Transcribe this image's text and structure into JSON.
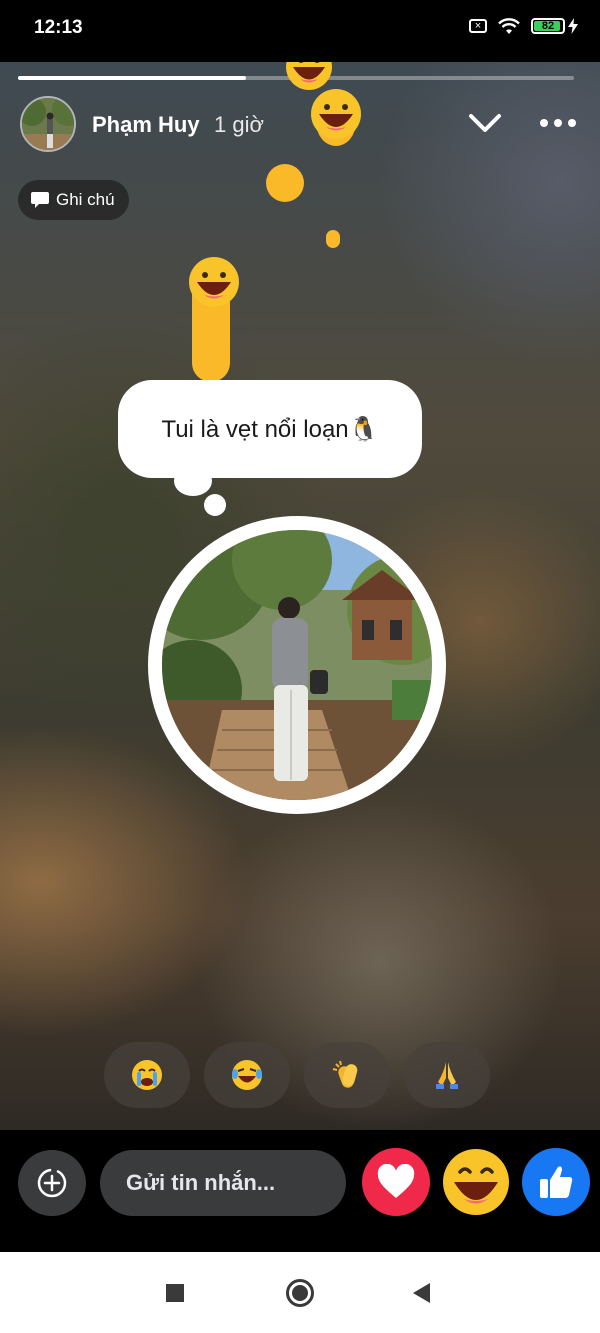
{
  "status_bar": {
    "time": "12:13",
    "battery_level": "82",
    "icons": [
      "sim-x-icon",
      "wifi-icon",
      "battery-icon",
      "charging-bolt-icon"
    ]
  },
  "story": {
    "progress_fraction": 0.41,
    "author": {
      "name": "Phạm Huy",
      "time": "1 giờ",
      "avatar": "avatar-photo"
    },
    "note_chip": {
      "label": "Ghi chú",
      "icon": "speech-bubble-icon"
    },
    "note_text": "Tui là vẹt nổi loạn🐧",
    "quick_reactions": [
      {
        "emoji": "😭",
        "name": "crying"
      },
      {
        "emoji": "😂",
        "name": "laughing-tears"
      },
      {
        "emoji": "👏",
        "name": "clapping"
      },
      {
        "emoji": "🙏",
        "name": "praying-hands"
      }
    ],
    "floating_emoji": "😄"
  },
  "message_bar": {
    "placeholder": "Gửi tin nhắn...",
    "reactions": [
      "heart",
      "haha",
      "like"
    ],
    "colors": {
      "heart": "#f0284a",
      "like": "#1877f2",
      "haha": "#f9c32a"
    }
  },
  "nav_bar": {
    "buttons": [
      "recents",
      "home",
      "back"
    ]
  }
}
